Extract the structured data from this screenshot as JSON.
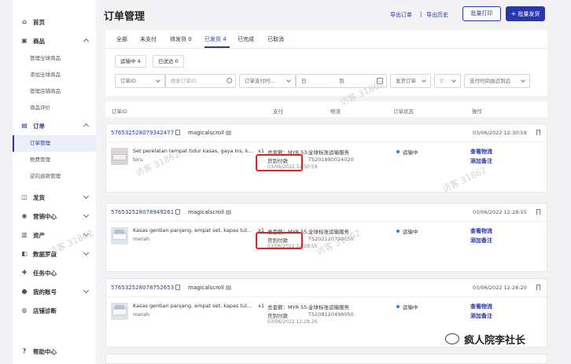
{
  "sidebar": {
    "items": [
      {
        "label": "首页",
        "icon": "home-icon"
      },
      {
        "label": "商品",
        "icon": "goods-icon"
      },
      {
        "label": "订单",
        "icon": "order-icon"
      },
      {
        "label": "发货",
        "icon": "ship-icon"
      },
      {
        "label": "营销中心",
        "icon": "marketing-icon"
      },
      {
        "label": "资产",
        "icon": "assets-icon"
      },
      {
        "label": "数据罗盘",
        "icon": "data-icon"
      },
      {
        "label": "任务中心",
        "icon": "task-icon"
      },
      {
        "label": "我的账号",
        "icon": "account-icon"
      },
      {
        "label": "店铺诊断",
        "icon": "diagnose-icon"
      },
      {
        "label": "帮助中心",
        "icon": "help-icon"
      }
    ],
    "goods_sub": [
      "管理全球商品",
      "添加全球商品",
      "管理店铺商品",
      "商品评价"
    ],
    "order_sub": [
      "订单管理",
      "税费管理",
      "逆向退款管理"
    ]
  },
  "header": {
    "title": "订单管理",
    "export_link": "导出订单",
    "separator": "|",
    "export_history": "导出历史",
    "batch_print": "批量打印",
    "batch_ship": "批量发货"
  },
  "tabs": [
    "全部",
    "未支付",
    "待发货 0",
    "已发货 4",
    "已完成",
    "已取消"
  ],
  "sub_tabs": [
    "运输中 4",
    "已送达 0"
  ],
  "filters": {
    "order_id": "订单ID",
    "search_placeholder": "搜索订单ID",
    "pay_time": "订单支付时...",
    "date_from": "日",
    "date_to": "到",
    "shipping": "发货订单",
    "sort": "支付时间由近到远"
  },
  "table_headers": [
    "订单ID",
    "支付",
    "物流",
    "订单状态",
    "操作"
  ],
  "orders": [
    {
      "id": "576532528079342477",
      "buyer": "magicalscroll",
      "time": "03/06/2022 12:30:59",
      "product": "Set perelatan tempat tidur kasas, gaya Ins, kar...",
      "qty": "x1",
      "variant": "biru",
      "total": "总金额：MYR 53...",
      "pay_status": "货到付款",
      "pay_time": "03/06/2022 12:30:59",
      "logistics": "全球标准运输服务",
      "tracking": "TS201880024020",
      "status": "运输中",
      "action1": "查看物流",
      "action2": "添加备注"
    },
    {
      "id": "576532528078949261",
      "buyer": "magicalscroll",
      "time": "03/06/2022 12:28:55",
      "product": "Kasas gentian panjang, empat set, kapas tulen...",
      "qty": "x1",
      "variant": "merah",
      "total": "总金额：MYR 55...",
      "pay_status": "货到付款",
      "pay_time": "03/06/2022 12:28:55",
      "logistics": "全球标准运输服务",
      "tracking": "TS202120798050",
      "status": "运输中",
      "action1": "查看物流",
      "action2": "添加备注"
    },
    {
      "id": "576532528078752653",
      "buyer": "magicalscroll",
      "time": "03/06/2022 12:28:20",
      "product": "Kasas gentian panjang, empat set, kapas tulen...",
      "qty": "x1",
      "variant": "merah",
      "total": "总金额：MYR 55...",
      "pay_status": "货到付款",
      "pay_time": "03/06/2022 12:28:20",
      "logistics": "全球标准运输服务",
      "tracking": "TS208120498050",
      "status": "运输中",
      "action1": "查看物流",
      "action2": "添加备注"
    }
  ],
  "watermark": "访客 31862",
  "brand": "疯人院李社长",
  "colors": {
    "accent": "#2a37a8",
    "highlight": "#e0221f",
    "status_dot": "#2a7ee0"
  }
}
